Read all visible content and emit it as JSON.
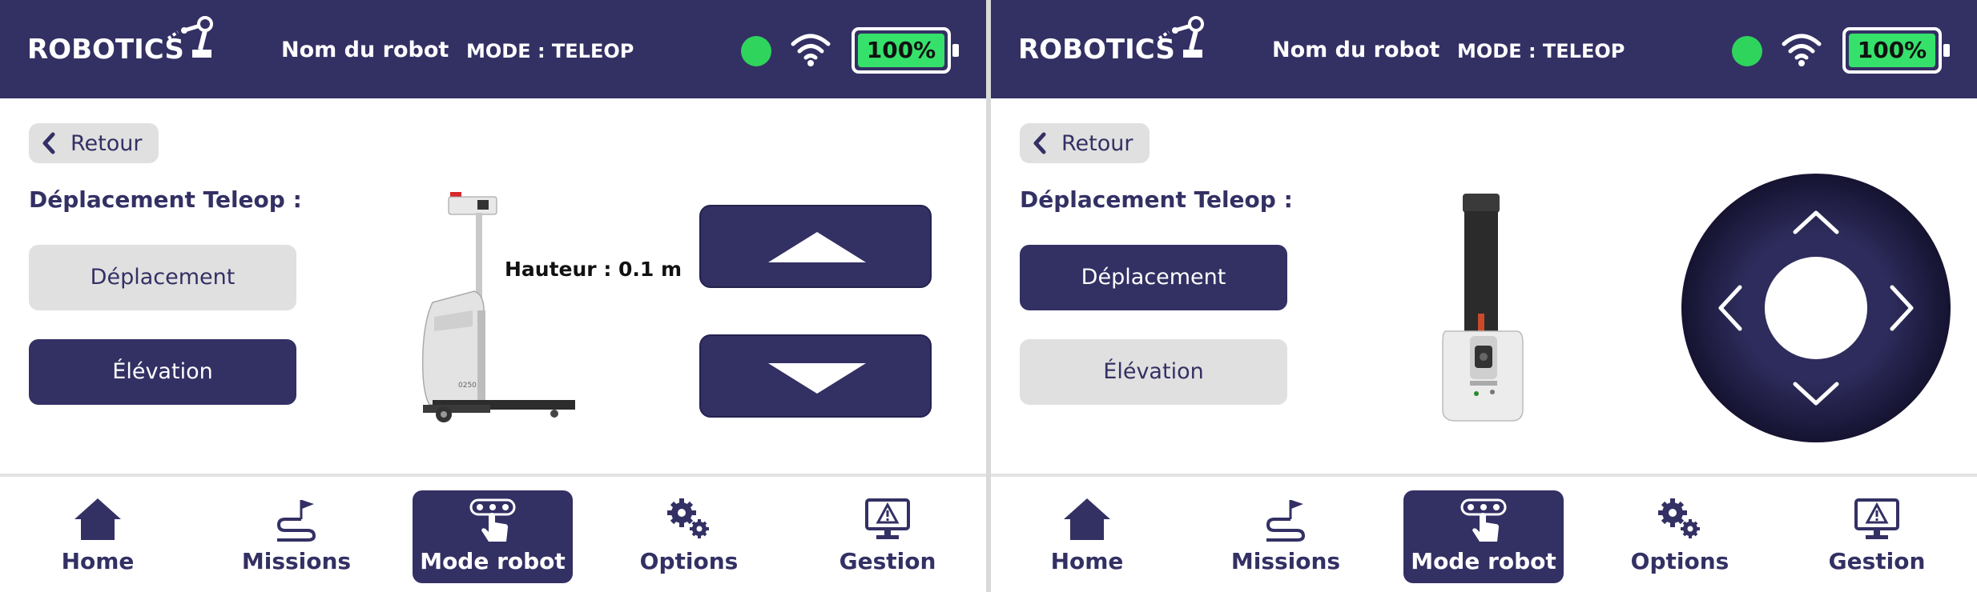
{
  "colors": {
    "primary": "#333064",
    "status_green": "#2fd45c",
    "battery_green": "#35e16b",
    "button_grey": "#e0e0e0"
  },
  "header": {
    "logo": "ROBOTICS",
    "robot_name": "Nom du robot",
    "mode": "MODE : TELEOP",
    "battery": "100%",
    "status_icon": "status-dot",
    "wifi_icon": "wifi-icon"
  },
  "back_label": "Retour",
  "section_title": "Déplacement Teleop :",
  "modes": {
    "deplacement": "Déplacement",
    "elevation": "Élévation"
  },
  "elevation_view": {
    "height_label": "Hauteur : 0.1 m",
    "active_mode": "elevation"
  },
  "deplacement_view": {
    "active_mode": "deplacement"
  },
  "nav": [
    {
      "label": "Home",
      "icon": "home-icon"
    },
    {
      "label": "Missions",
      "icon": "missions-flag-icon"
    },
    {
      "label": "Mode robot",
      "icon": "touch-control-icon",
      "active": true
    },
    {
      "label": "Options",
      "icon": "gears-icon"
    },
    {
      "label": "Gestion",
      "icon": "monitor-warning-icon"
    }
  ]
}
